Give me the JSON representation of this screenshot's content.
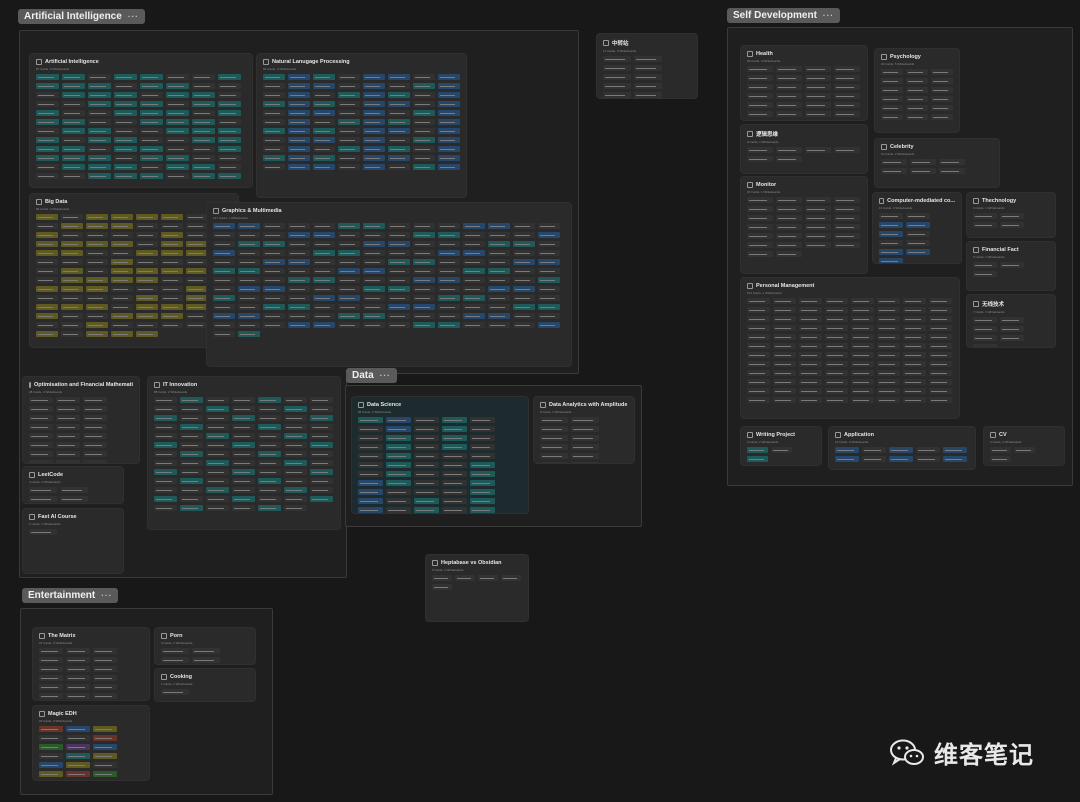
{
  "spaces": [
    {
      "id": "ai",
      "label": "Artificial Intelligence"
    },
    {
      "id": "self",
      "label": "Self Development"
    },
    {
      "id": "data",
      "label": "Data"
    },
    {
      "id": "ent",
      "label": "Entertainment"
    }
  ],
  "space_menu": "···",
  "cards": [
    {
      "id": "ai-main",
      "title": "Artificial Intelligence",
      "sub": "87 Cards, 6 Whiteboards"
    },
    {
      "id": "nlp",
      "title": "Natural Lanugage Processing",
      "sub": "66 Cards, 2 Whiteboards"
    },
    {
      "id": "bigdata",
      "title": "Big Data",
      "sub": "86 Cards, 4 Whiteboards"
    },
    {
      "id": "graphics",
      "title": "Graphics & Multimedia",
      "sub": "147 Cards, 1 Whiteboards"
    },
    {
      "id": "opt",
      "title": "Optimisation and Financial Mathemati...",
      "sub": "28 Cards, 2 Whiteboards"
    },
    {
      "id": "it",
      "title": "IT Innovation",
      "sub": "88 Cards, 2 Whiteboards"
    },
    {
      "id": "leetcode",
      "title": "LeetCode",
      "sub": "4 Cards, 2 Whiteboards"
    },
    {
      "id": "fastai",
      "title": "Fast AI Course",
      "sub": "1 Cards, 1 Whiteboards"
    },
    {
      "id": "zhongzhuan",
      "title": "中转站",
      "sub": "17 Cards, 5 Whiteboards"
    },
    {
      "id": "health",
      "title": "Health",
      "sub": "36 Cards, 4 Whiteboards"
    },
    {
      "id": "psych",
      "title": "Psychology",
      "sub": "22 Cards, 5 Whiteboards"
    },
    {
      "id": "logic",
      "title": "逻辑思维",
      "sub": "6 Cards, 1 Whiteboards"
    },
    {
      "id": "celebrity",
      "title": "Celebrity",
      "sub": "10 Cards, 2 Whiteboards"
    },
    {
      "id": "monitor",
      "title": "Monitor",
      "sub": "30 Cards, 1 Whiteboards"
    },
    {
      "id": "cmc",
      "title": "Computer-mdediated co...",
      "sub": "13 Cards, 2 Whiteboards"
    },
    {
      "id": "techno",
      "title": "Thechnology",
      "sub": "4 Cards, 1 Whiteboards"
    },
    {
      "id": "fin",
      "title": "Financial Fact",
      "sub": "3 Cards, 1 Whiteboards"
    },
    {
      "id": "pm",
      "title": "Personal Management",
      "sub": "102 Cards, 1 Whiteboards"
    },
    {
      "id": "wireless",
      "title": "无线技术",
      "sub": "7 Cards, 1 Whiteboards"
    },
    {
      "id": "writing",
      "title": "Writing Project",
      "sub": "3 Cards, 2 Whiteboards"
    },
    {
      "id": "app",
      "title": "Application",
      "sub": "10 Cards, 2 Whiteboards"
    },
    {
      "id": "cv",
      "title": "CV",
      "sub": "3 Cards, 2 Whiteboards"
    },
    {
      "id": "ds",
      "title": "Data Science",
      "sub": "85 Cards, 2 Whiteboards"
    },
    {
      "id": "amp",
      "title": "Data Analytics with Amplitude",
      "sub": "9 Cards, 1 Whiteboards"
    },
    {
      "id": "hapta",
      "title": "Heptabase vs Obsidian",
      "sub": "5 Cards, 1 Whiteboards"
    },
    {
      "id": "matrix",
      "title": "The Matrix",
      "sub": "21 Cards, 2 Whiteboards"
    },
    {
      "id": "porn",
      "title": "Porn",
      "sub": "4 Cards, 1 Whiteboards"
    },
    {
      "id": "cooking",
      "title": "Cooking",
      "sub": "1 Cards, 1 Whiteboards"
    },
    {
      "id": "magic",
      "title": "Magic EDH",
      "sub": "22 Cards, 2 Whiteboards"
    }
  ],
  "watermark": "维客笔记",
  "colors": {
    "bg": "#181818",
    "card": "#2a2a2a",
    "teal": "#1f5a5a",
    "blue": "#26466a",
    "olive": "#5f5a22"
  }
}
